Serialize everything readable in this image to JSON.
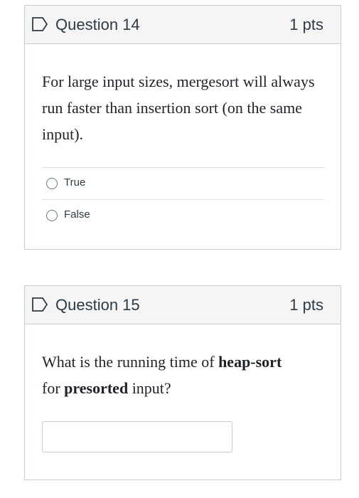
{
  "questions": [
    {
      "title": "Question 14",
      "points": "1 pts",
      "text": "For large input sizes, mergesort will always run faster than insertion sort (on the same input).",
      "answers": [
        "True",
        "False"
      ]
    },
    {
      "title": "Question 15",
      "points": "1 pts",
      "text_parts": [
        "What is the running time of ",
        "heap-sort",
        " for ",
        "presorted",
        " input?"
      ],
      "answer_value": ""
    }
  ],
  "colors": {
    "flag_icon": "#2d3b45",
    "header_bg": "#f5f5f5",
    "border": "#c7cdd1"
  },
  "icons": {
    "flag": "flag-icon",
    "radio": "radio-button"
  }
}
